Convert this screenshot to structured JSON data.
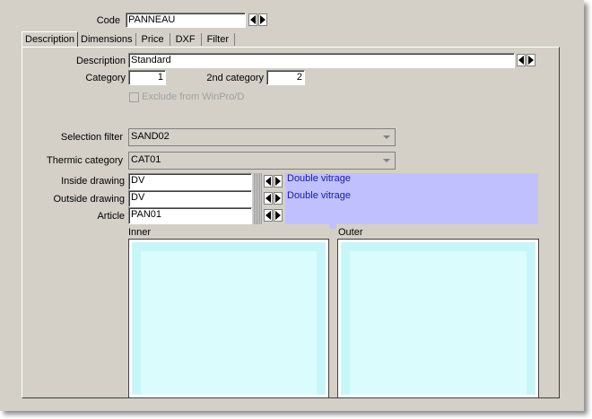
{
  "header": {
    "code_label": "Code",
    "code_value": "PANNEAU"
  },
  "tabs": [
    {
      "label": "Description",
      "active": true
    },
    {
      "label": "Dimensions",
      "active": false
    },
    {
      "label": "Price",
      "active": false
    },
    {
      "label": "DXF",
      "active": false
    },
    {
      "label": "Filter",
      "active": false
    }
  ],
  "form": {
    "description_label": "Description",
    "description_value": "Standard",
    "category_label": "Category",
    "category_value": "1",
    "category2_label": "2nd category",
    "category2_value": "2",
    "exclude_label": "Exclude from WinPro/D",
    "exclude_checked": false,
    "selection_filter_label": "Selection filter",
    "selection_filter_value": "SAND02",
    "thermic_label": "Thermic category",
    "thermic_value": "CAT01",
    "inside_drawing_label": "Inside drawing",
    "inside_drawing_value": "DV",
    "inside_drawing_desc": "Double vitrage",
    "outside_drawing_label": "Outside drawing",
    "outside_drawing_value": "DV",
    "outside_drawing_desc": "Double vitrage",
    "article_label": "Article",
    "article_value": "PAN01",
    "article_desc": ""
  },
  "previews": {
    "inner_label": "Inner",
    "outer_label": "Outer"
  },
  "colors": {
    "window_bg": "#d4d0c8",
    "desc_highlight": "#c0c0ff",
    "preview_fill": "#c8f6f8"
  },
  "icons": [
    "arrow-left-icon",
    "arrow-right-icon",
    "dropdown-arrow-icon",
    "checkbox-icon"
  ]
}
